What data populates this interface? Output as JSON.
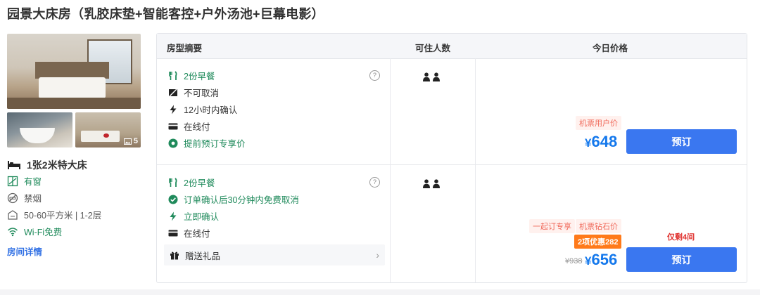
{
  "room": {
    "title": "园景大床房（乳胶床垫+智能客控+户外汤池+巨幕电影）",
    "photo_count": "5",
    "bed": "1张2米特大床",
    "features": [
      {
        "icon": "window-icon",
        "label": "有窗",
        "color": "green"
      },
      {
        "icon": "no-smoking-icon",
        "label": "禁烟",
        "color": "gray"
      },
      {
        "icon": "area-icon",
        "label": "50-60平方米 | 1-2层",
        "color": "gray"
      },
      {
        "icon": "wifi-icon",
        "label": "Wi-Fi免费",
        "color": "green"
      }
    ],
    "detail_link": "房间详情"
  },
  "table": {
    "headers": [
      "房型摘要",
      "可住人数",
      "今日价格"
    ],
    "rows": [
      {
        "policies": [
          {
            "icon": "fork-knife-icon",
            "label": "2份早餐",
            "color": "green"
          },
          {
            "icon": "no-cancel-icon",
            "label": "不可取消",
            "color": "dark"
          },
          {
            "icon": "lightning-icon",
            "label": "12小时内确认",
            "color": "dark"
          },
          {
            "icon": "card-icon",
            "label": "在线付",
            "color": "dark"
          },
          {
            "icon": "discount-icon",
            "label": "提前预订专享价",
            "color": "green"
          }
        ],
        "help_symbol": "?",
        "guests": 2,
        "tags": [
          "机票用户价"
        ],
        "price": "648",
        "currency": "¥",
        "book_label": "预订"
      },
      {
        "policies": [
          {
            "icon": "fork-knife-icon",
            "label": "2份早餐",
            "color": "green"
          },
          {
            "icon": "check-circle-icon",
            "label": "订单确认后30分钟内免费取消",
            "color": "green"
          },
          {
            "icon": "lightning-icon",
            "label": "立即确认",
            "color": "green"
          },
          {
            "icon": "card-icon",
            "label": "在线付",
            "color": "dark"
          }
        ],
        "gift": {
          "label": "赠送礼品",
          "chevron": "›"
        },
        "help_symbol": "?",
        "guests": 2,
        "tags": [
          "一起订专享",
          "机票钻石价"
        ],
        "discount_badge": "2项优惠282",
        "remaining": "仅剩4间",
        "original_price": "¥938",
        "price": "656",
        "currency": "¥",
        "book_label": "预订"
      }
    ]
  },
  "colors": {
    "accent": "#3a77f0",
    "price": "#1478ec",
    "green": "#1f8a5b",
    "tag_red": "#f06a5b",
    "badge_orange": "#ff7a1a"
  }
}
